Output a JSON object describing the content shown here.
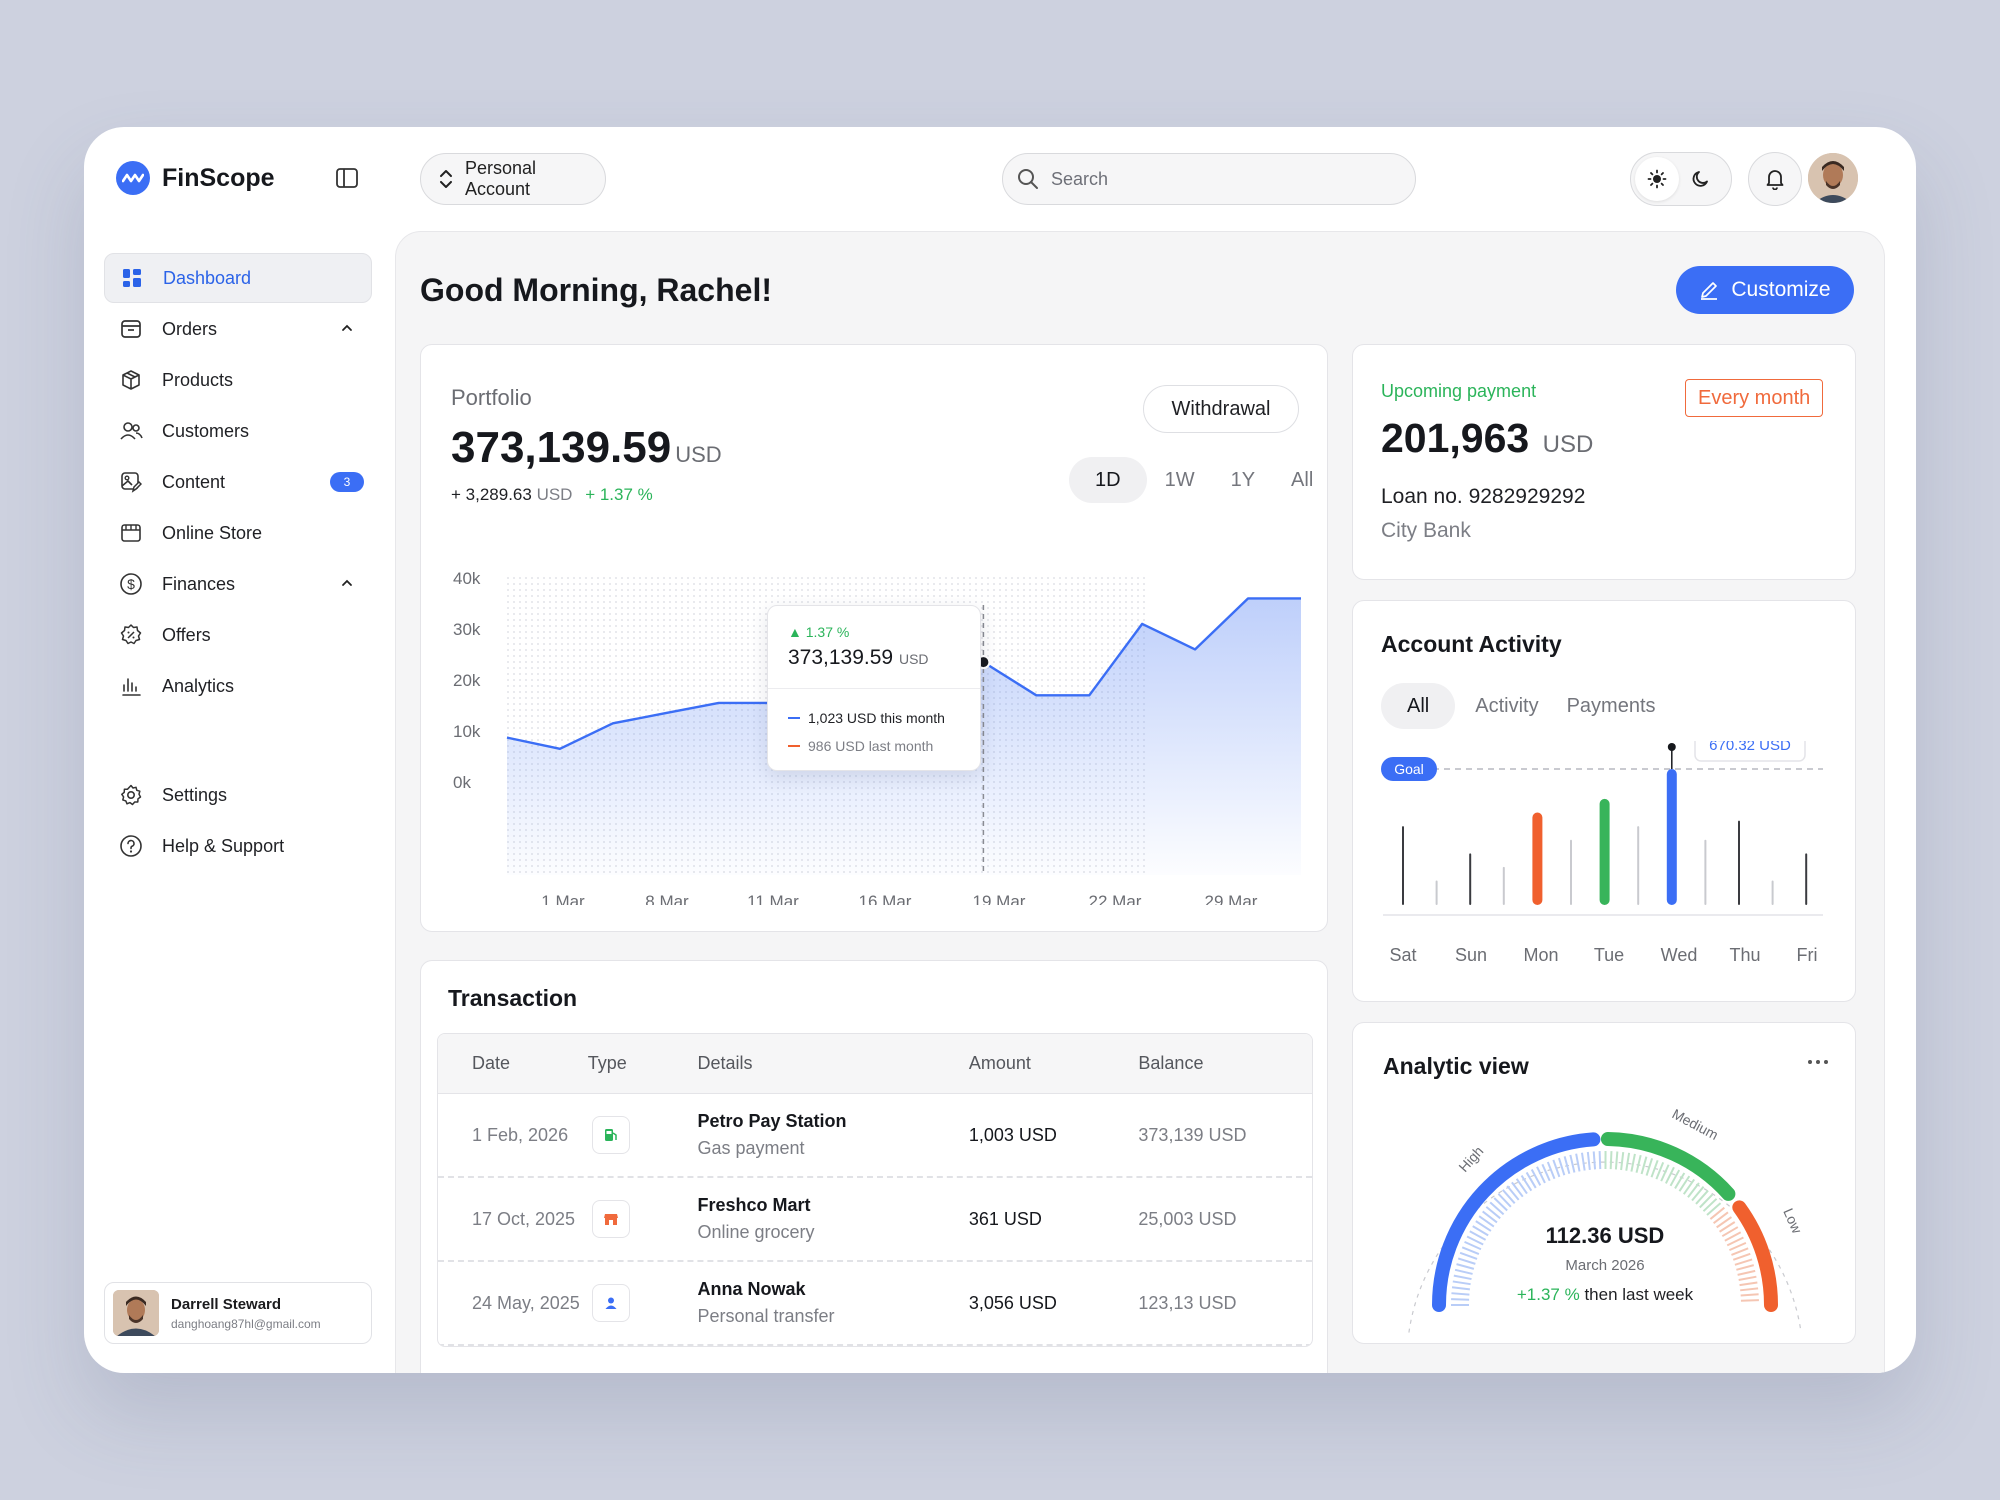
{
  "brand": {
    "name": "FinScope"
  },
  "header": {
    "account_label": "Personal Account",
    "search_placeholder": "Search"
  },
  "sidebar": {
    "items": [
      {
        "label": "Dashboard",
        "icon": "dashboard-icon",
        "active": true
      },
      {
        "label": "Orders",
        "icon": "orders-icon",
        "expand": true
      },
      {
        "label": "Products",
        "icon": "box-icon"
      },
      {
        "label": "Customers",
        "icon": "users-icon"
      },
      {
        "label": "Content",
        "icon": "image-edit-icon",
        "badge": "3"
      },
      {
        "label": "Online Store",
        "icon": "store-icon"
      },
      {
        "label": "Finances",
        "icon": "dollar-icon",
        "expand": true
      },
      {
        "label": "Offers",
        "icon": "discount-icon"
      },
      {
        "label": "Analytics",
        "icon": "bar-chart-icon"
      }
    ],
    "bottom_items": [
      {
        "label": "Settings",
        "icon": "gear-icon"
      },
      {
        "label": "Help & Support",
        "icon": "help-icon"
      }
    ],
    "user": {
      "name": "Darrell Steward",
      "email": "danghoang87hl@gmail.com"
    }
  },
  "main": {
    "greeting": "Good Morning, Rachel!",
    "customize_label": "Customize"
  },
  "portfolio": {
    "label": "Portfolio",
    "value": "373,139.59",
    "currency": "USD",
    "change_amount": "+ 3,289.63",
    "change_currency": "USD",
    "change_pct": "+ 1.37 %",
    "withdraw_label": "Withdrawal",
    "ranges": [
      "1D",
      "1W",
      "1Y",
      "All"
    ],
    "active_range": "1D",
    "tooltip": {
      "pct": "1.37 %",
      "value": "373,139.59",
      "currency": "USD",
      "this_month": "1,023 USD this month",
      "last_month": "986 USD last month"
    }
  },
  "chart_data": [
    {
      "type": "area",
      "y_ticks": [
        "40k",
        "30k",
        "20k",
        "10k",
        "0k"
      ],
      "ylim": [
        0,
        40000
      ],
      "x_ticks": [
        "1 Mar",
        "8 Mar",
        "11 Mar",
        "16 Mar",
        "19 Mar",
        "22 Mar",
        "29 Mar"
      ],
      "series": [
        {
          "values": [
            8700,
            6500,
            11500,
            13500,
            15500,
            15500,
            18500,
            15500,
            16000,
            23500,
            17000,
            17000,
            31000,
            26000,
            36000,
            36000
          ]
        }
      ],
      "highlight_index": 9,
      "colors": {
        "line": "#3b6ef5"
      }
    },
    {
      "type": "bar",
      "categories": [
        "Sat",
        "Sun",
        "Mon",
        "Tue",
        "Wed",
        "Thu",
        "Fri"
      ],
      "goal_label": "Goal",
      "tooltip": "670.32 USD",
      "bars": [
        {
          "h": 0.58,
          "color": "#3a3b40",
          "w": 2
        },
        {
          "h": 0.18,
          "color": "#c9cacf",
          "w": 2
        },
        {
          "h": 0.38,
          "color": "#3a3b40",
          "w": 2
        },
        {
          "h": 0.28,
          "color": "#c9cacf",
          "w": 2
        },
        {
          "h": 0.68,
          "color": "#f0602e",
          "w": 10
        },
        {
          "h": 0.48,
          "color": "#c9cacf",
          "w": 2
        },
        {
          "h": 0.78,
          "color": "#38b45a",
          "w": 10
        },
        {
          "h": 0.58,
          "color": "#c9cacf",
          "w": 2
        },
        {
          "h": 1.0,
          "color": "#3b6ef5",
          "w": 10
        },
        {
          "h": 0.48,
          "color": "#c9cacf",
          "w": 2
        },
        {
          "h": 0.62,
          "color": "#3a3b40",
          "w": 2
        },
        {
          "h": 0.18,
          "color": "#c9cacf",
          "w": 2
        },
        {
          "h": 0.38,
          "color": "#3a3b40",
          "w": 2
        }
      ]
    }
  ],
  "upcoming": {
    "label": "Upcoming payment",
    "frequency": "Every month",
    "amount": "201,963",
    "currency": "USD",
    "loan": "Loan no. 9282929292",
    "bank": "City Bank"
  },
  "activity": {
    "title": "Account Activity",
    "tabs": [
      "All",
      "Activity",
      "Payments"
    ]
  },
  "analytic": {
    "title": "Analytic view",
    "labels": {
      "high": "High",
      "medium": "Medium",
      "low": "Low"
    },
    "value": "112.36 USD",
    "date": "March 2026",
    "change_pct": "+1.37 %",
    "change_text": "then last week"
  },
  "transaction": {
    "title": "Transaction",
    "columns": [
      "Date",
      "Type",
      "Details",
      "Amount",
      "Balance"
    ],
    "rows": [
      {
        "date": "1 Feb, 2026",
        "type_icon": "fuel-icon",
        "type_color": "#2bb45a",
        "name": "Petro Pay Station",
        "sub": "Gas payment",
        "amount": "1,003 USD",
        "balance": "373,139 USD"
      },
      {
        "date": "17 Oct, 2025",
        "type_icon": "shop-icon",
        "type_color": "#f06a3c",
        "name": "Freshco Mart",
        "sub": "Online grocery",
        "amount": "361 USD",
        "balance": "25,003 USD"
      },
      {
        "date": "24 May, 2025",
        "type_icon": "person-icon",
        "type_color": "#3b6ef5",
        "name": "Anna Nowak",
        "sub": "Personal transfer",
        "amount": "3,056 USD",
        "balance": "123,13 USD"
      }
    ]
  }
}
